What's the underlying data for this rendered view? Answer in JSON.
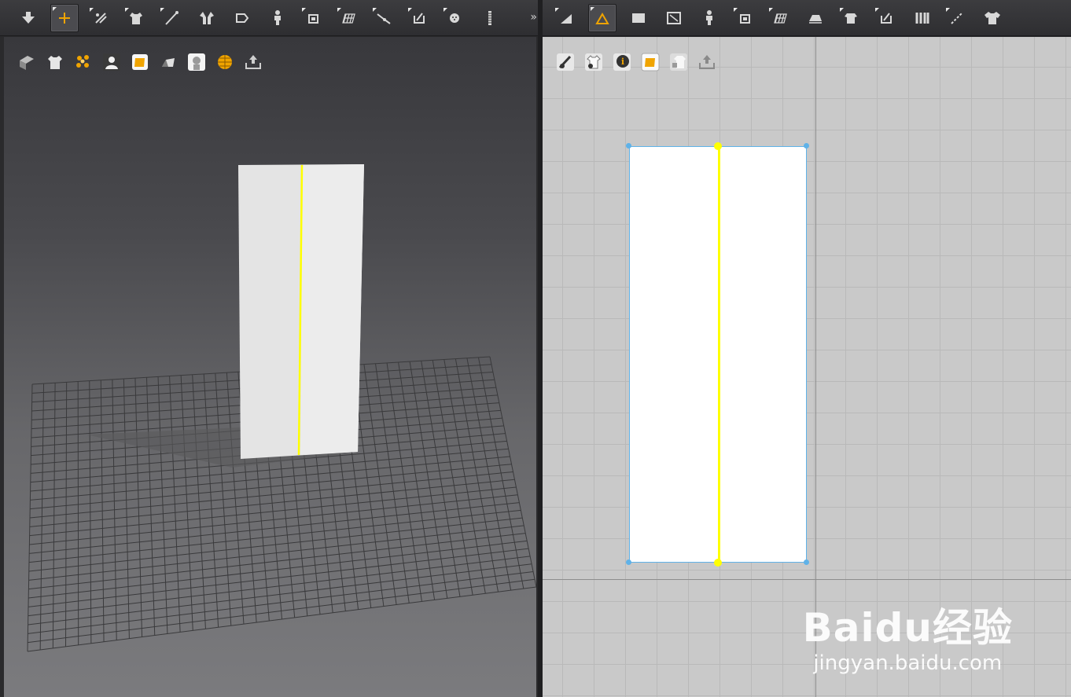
{
  "toolbar_3d": {
    "tools": [
      {
        "icon": "arrow-down-icon"
      },
      {
        "icon": "transform-move-icon",
        "active": true
      },
      {
        "icon": "fold-arrangement-icon"
      },
      {
        "icon": "select-garment-icon"
      },
      {
        "icon": "line-tool-icon"
      },
      {
        "icon": "fold-avatar-icon"
      },
      {
        "icon": "flatten-icon"
      },
      {
        "icon": "pin-avatar-icon"
      },
      {
        "icon": "tack-icon"
      },
      {
        "icon": "grid-pattern-icon"
      },
      {
        "icon": "edit-curve-icon"
      },
      {
        "icon": "sewing-icon"
      },
      {
        "icon": "button-icon"
      },
      {
        "icon": "zipper-icon"
      }
    ],
    "expand_label": "»"
  },
  "toolbar_2d": {
    "tools": [
      {
        "icon": "edit-pattern-icon"
      },
      {
        "icon": "edit-point-line-icon",
        "active": true
      },
      {
        "icon": "rectangle-icon"
      },
      {
        "icon": "polygon-icon"
      },
      {
        "icon": "internal-shape-icon"
      },
      {
        "icon": "dart-icon"
      },
      {
        "icon": "grid-texture-icon"
      },
      {
        "icon": "iron-icon"
      },
      {
        "icon": "segment-sewing-icon"
      },
      {
        "icon": "free-sewing-icon"
      },
      {
        "icon": "pleat-icon"
      },
      {
        "icon": "ruler-icon"
      },
      {
        "icon": "garment-icon"
      }
    ]
  },
  "view_3d_buttons": [
    "display-fabric-icon",
    "display-garment-icon",
    "display-particles-icon",
    "display-avatar-icon",
    "texture-mode-icon",
    "shaded-mode-icon",
    "avatar-silhouette-icon",
    "render-icon",
    "export-icon"
  ],
  "view_2d_buttons": [
    "show-pattern-icon",
    "show-garment-icon",
    "info-icon",
    "texture-2d-icon",
    "lock-garment-icon",
    "export-2d-icon"
  ],
  "watermark": {
    "logo": "Baidu经验",
    "url": "jingyan.baidu.com"
  },
  "colors": {
    "seam": "#ffff00",
    "selection": "#5fb2e8",
    "pattern_fill": "#ffffff",
    "panel_bg": "#c9c9c9"
  }
}
